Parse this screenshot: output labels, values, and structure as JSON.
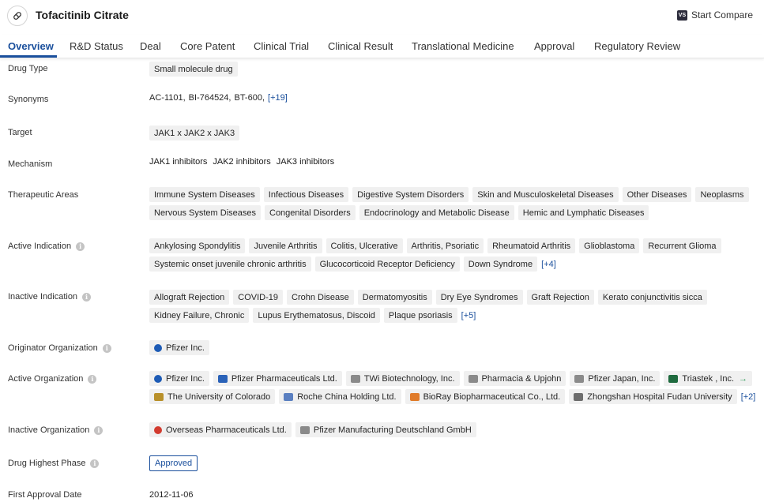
{
  "header": {
    "title": "Tofacitinib Citrate",
    "compare_badge": "VS",
    "compare_label": "Start Compare"
  },
  "tabs": [
    {
      "label": "Overview"
    },
    {
      "label": "R&D Status"
    },
    {
      "label": "Deal"
    },
    {
      "label": "Core Patent"
    },
    {
      "label": "Clinical Trial"
    },
    {
      "label": "Clinical Result"
    },
    {
      "label": "Translational Medicine"
    },
    {
      "label": "Approval"
    },
    {
      "label": "Regulatory Review"
    }
  ],
  "rows": {
    "drug_type": {
      "label": "Drug Type",
      "tags": [
        "Small molecule drug"
      ]
    },
    "synonyms": {
      "label": "Synonyms",
      "items": [
        "AC-1101,",
        "BI-764524,",
        "BT-600,"
      ],
      "more": "[+19]"
    },
    "target": {
      "label": "Target",
      "tags": [
        "JAK1 x JAK2 x JAK3"
      ]
    },
    "mechanism": {
      "label": "Mechanism",
      "items": [
        "JAK1 inhibitors",
        "JAK2 inhibitors",
        "JAK3 inhibitors"
      ]
    },
    "therapeutic_areas": {
      "label": "Therapeutic Areas",
      "tags": [
        "Immune System Diseases",
        "Infectious Diseases",
        "Digestive System Disorders",
        "Skin and Musculoskeletal Diseases",
        "Other Diseases",
        "Neoplasms",
        "Nervous System Diseases",
        "Congenital Disorders",
        "Endocrinology and Metabolic Disease",
        "Hemic and Lymphatic Diseases"
      ]
    },
    "active_indication": {
      "label": "Active Indication",
      "tags": [
        "Ankylosing Spondylitis",
        "Juvenile Arthritis",
        "Colitis, Ulcerative",
        "Arthritis, Psoriatic",
        "Rheumatoid Arthritis",
        "Glioblastoma",
        "Recurrent Glioma",
        "Systemic onset juvenile chronic arthritis",
        "Glucocorticoid Receptor Deficiency",
        "Down Syndrome"
      ],
      "more": "[+4]"
    },
    "inactive_indication": {
      "label": "Inactive Indication",
      "tags": [
        "Allograft Rejection",
        "COVID-19",
        "Crohn Disease",
        "Dermatomyositis",
        "Dry Eye Syndromes",
        "Graft Rejection",
        "Kerato conjunctivitis sicca",
        "Kidney Failure, Chronic",
        "Lupus Erythematosus, Discoid",
        "Plaque psoriasis"
      ],
      "more": "[+5]"
    },
    "originator_org": {
      "label": "Originator Organization",
      "orgs": [
        {
          "name": "Pfizer Inc.",
          "color": "#1d5bb5"
        }
      ]
    },
    "active_org": {
      "label": "Active Organization",
      "orgs": [
        {
          "name": "Pfizer Inc.",
          "color": "#1d5bb5"
        },
        {
          "name": "Pfizer Pharmaceuticals Ltd.",
          "color": "#2a62b8"
        },
        {
          "name": "TWi Biotechnology, Inc.",
          "color": "#8a8a8a"
        },
        {
          "name": "Pharmacia & Upjohn",
          "color": "#8a8a8a"
        },
        {
          "name": "Pfizer Japan, Inc.",
          "color": "#8a8a8a"
        },
        {
          "name": "Triastek , Inc.",
          "color": "#1f6b3f"
        },
        {
          "name": "The University of Colorado",
          "color": "#b8902a"
        },
        {
          "name": "Roche China Holding Ltd.",
          "color": "#5a7fc0"
        },
        {
          "name": "BioRay Biopharmaceutical Co., Ltd.",
          "color": "#e07b2a"
        },
        {
          "name": "Zhongshan Hospital Fudan University",
          "color": "#6d6d6d"
        }
      ],
      "more": "[+2]"
    },
    "inactive_org": {
      "label": "Inactive Organization",
      "orgs": [
        {
          "name": "Overseas Pharmaceuticals Ltd.",
          "color": "#d23b2f"
        },
        {
          "name": "Pfizer Manufacturing Deutschland GmbH",
          "color": "#8a8a8a"
        }
      ]
    },
    "highest_phase": {
      "label": "Drug Highest Phase",
      "value": "Approved"
    },
    "first_approval": {
      "label": "First Approval Date",
      "value": "2012-11-06"
    }
  },
  "info_glyph": "i",
  "colors": {
    "accent": "#1a4f9c",
    "tag_bg": "#f0f0f0"
  }
}
